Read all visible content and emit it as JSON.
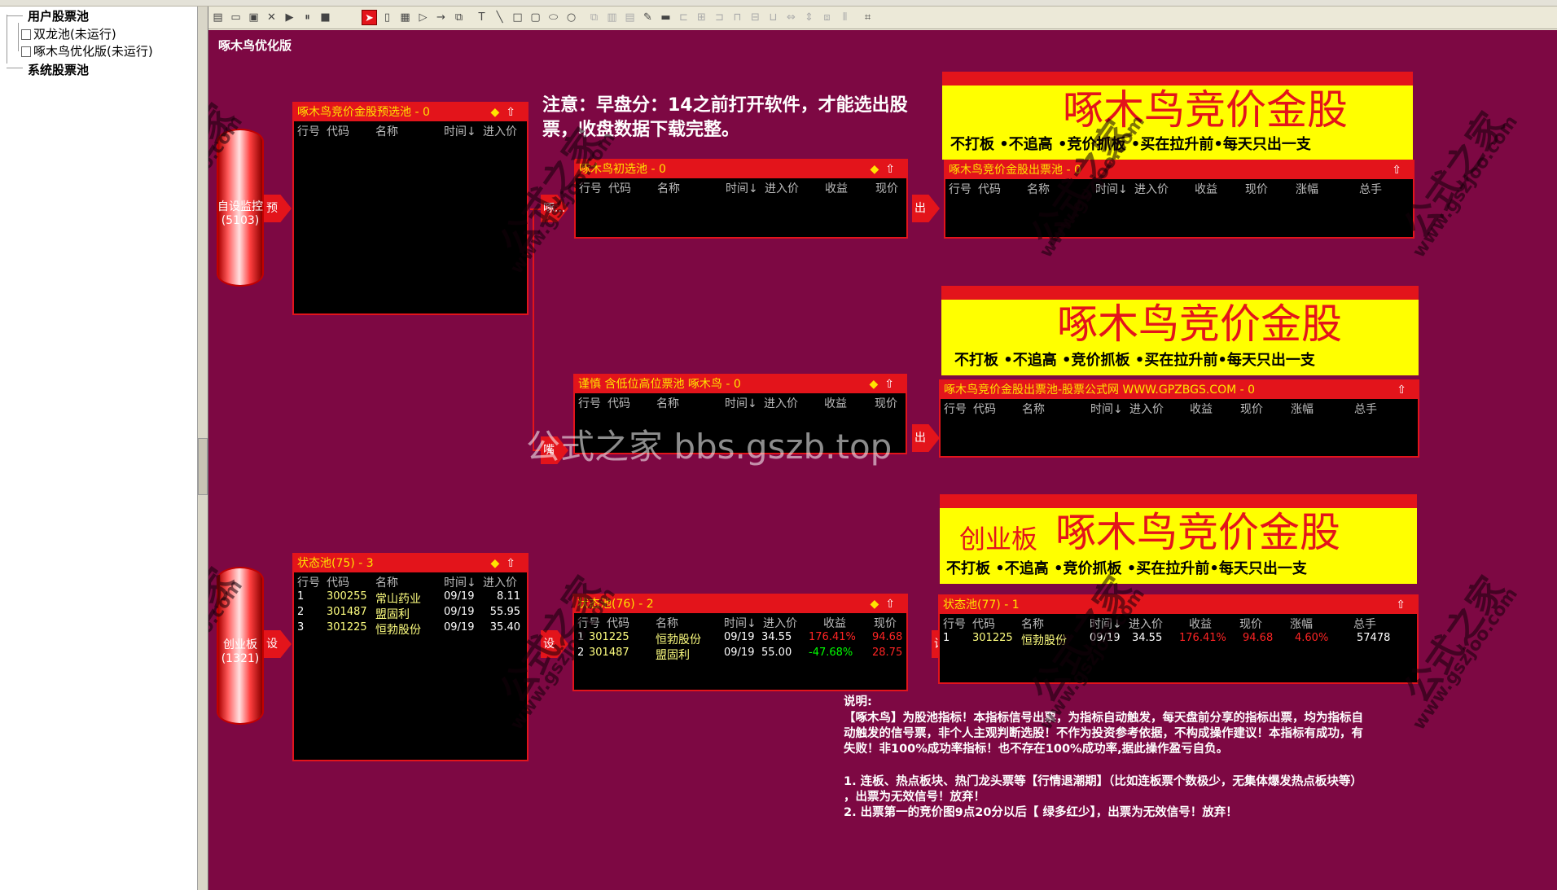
{
  "tree": {
    "user_pool": "用户股票池",
    "item1": "双龙池(未运行)",
    "item2": "啄木鸟优化版(未运行)",
    "system_pool": "系统股票池"
  },
  "canvas_title": "啄木鸟优化版",
  "cylinders": {
    "top": {
      "label": "自设监控",
      "count": "(5103)"
    },
    "bottom": {
      "label": "创业板",
      "count": "(1321)"
    }
  },
  "arrows": {
    "a1": "预",
    "a2": "啄...",
    "a3": "嘴",
    "a4": "出",
    "a5": "出",
    "b1": "设",
    "b2": "设",
    "b3": "设"
  },
  "notice": {
    "line1": "注意：早盘分：14之前打开软件，才能选出股",
    "line2": "票，收盘数据下载完整。"
  },
  "pools": {
    "p1": {
      "title": "啄木鸟竞价金股预选池 - 0",
      "cols": [
        "行号",
        "代码",
        "名称",
        "时间↓",
        "进入价"
      ]
    },
    "p2": {
      "title": "啄木鸟初选池 - 0",
      "cols": [
        "行号",
        "代码",
        "名称",
        "时间↓",
        "进入价",
        "收益",
        "现价"
      ]
    },
    "p3": {
      "title": "啄木鸟竞价金股出票池 - 0",
      "cols": [
        "行号",
        "代码",
        "名称",
        "时间↓",
        "进入价",
        "收益",
        "现价",
        "涨幅",
        "总手"
      ]
    },
    "p4": {
      "title": "谨慎 含低位高位票池 啄木鸟 - 0",
      "cols": [
        "行号",
        "代码",
        "名称",
        "时间↓",
        "进入价",
        "收益",
        "现价"
      ]
    },
    "p5": {
      "title": "啄木鸟竞价金股出票池-股票公式网 WWW.GPZBGS.COM - 0",
      "cols": [
        "行号",
        "代码",
        "名称",
        "时间↓",
        "进入价",
        "收益",
        "现价",
        "涨幅",
        "总手"
      ]
    },
    "p6": {
      "title": "状态池(75) - 3",
      "cols": [
        "行号",
        "代码",
        "名称",
        "时间↓",
        "进入价"
      ],
      "rows": [
        [
          "1",
          "300255",
          "常山药业",
          "09/19",
          "8.11"
        ],
        [
          "2",
          "301487",
          "盟固利",
          "09/19",
          "55.95"
        ],
        [
          "3",
          "301225",
          "恒勃股份",
          "09/19",
          "35.40"
        ]
      ]
    },
    "p7": {
      "title": "状态池(76) - 2",
      "cols": [
        "行号",
        "代码",
        "名称",
        "时间↓",
        "进入价",
        "收益",
        "现价"
      ],
      "rows": [
        [
          "1",
          "301225",
          "恒勃股份",
          "09/19",
          "34.55",
          "176.41%",
          "94.68"
        ],
        [
          "2",
          "301487",
          "盟固利",
          "09/19",
          "55.00",
          "-47.68%",
          "28.75"
        ]
      ]
    },
    "p8": {
      "title": "状态池(77) - 1",
      "cols": [
        "行号",
        "代码",
        "名称",
        "时间↓",
        "进入价",
        "收益",
        "现价",
        "涨幅",
        "总手"
      ],
      "rows": [
        [
          "1",
          "301225",
          "恒勃股份",
          "09/19",
          "34.55",
          "176.41%",
          "94.68",
          "4.60%",
          "57478"
        ]
      ]
    }
  },
  "banners": {
    "b1": {
      "title": "啄木鸟竞价金股",
      "sub": "不打板 •不追高 •竞价抓板 •买在拉升前•每天只出一支"
    },
    "b2": {
      "title": "啄木鸟竞价金股",
      "sub": "不打板 •不追高 •竞价抓板 •买在拉升前•每天只出一支"
    },
    "b3": {
      "prefix": "创业板",
      "title": "啄木鸟竞价金股",
      "sub": "不打板 •不追高 •竞价抓板 •买在拉升前•每天只出一支"
    }
  },
  "explanation": {
    "heading": "说明:",
    "l1": "【啄木鸟】为股池指标！本指标信号出票，为指标自动触发，每天盘前分享的指标出票，均为指标自",
    "l2": "动触发的信号票，非个人主观判断选股！不作为投资参考依据，不构成操作建议！本指标有成功，有",
    "l3": "失败！非100%成功率指标！也不存在100%成功率,据此操作盈亏自负。",
    "l4": "1. 连板、热点板块、热门龙头票等【行情退潮期】（比如连板票个数极少，无集体爆发热点板块等）",
    "l5": "，出票为无效信号！放弃！",
    "l6": "2. 出票第一的竞价图9点20分以后【 绿多红少】，出票为无效信号！放弃！"
  },
  "watermarks": {
    "cn": "公式之家",
    "url": "www.gszjoo.com",
    "center": "公式之家 bbs.gszb.top"
  }
}
